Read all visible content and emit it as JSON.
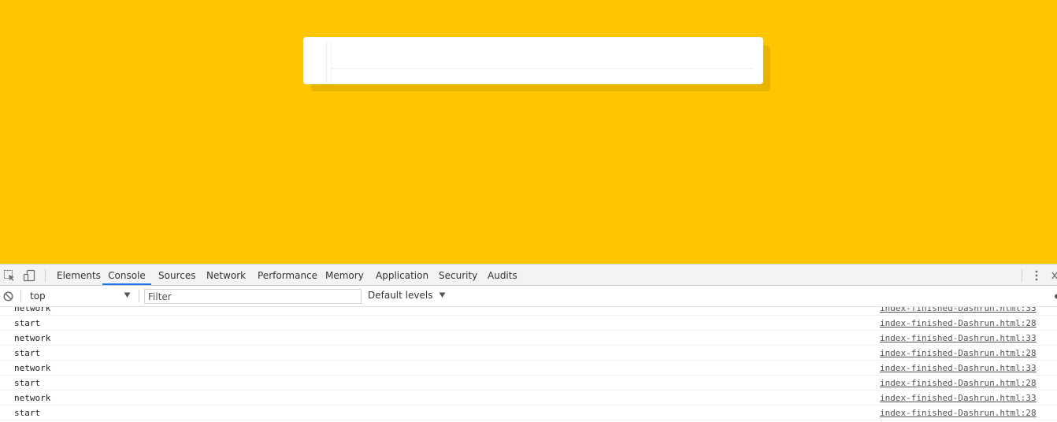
{
  "page": {
    "background_color": "#ffc600",
    "card_color": "#ffffff"
  },
  "devtools": {
    "toolbar_icons": [
      "inspect-element-icon",
      "device-toolbar-icon"
    ],
    "tabs": [
      {
        "label": "Elements",
        "active": false
      },
      {
        "label": "Console",
        "active": true
      },
      {
        "label": "Sources",
        "active": false
      },
      {
        "label": "Network",
        "active": false
      },
      {
        "label": "Performance",
        "active": false
      },
      {
        "label": "Memory",
        "active": false
      },
      {
        "label": "Application",
        "active": false
      },
      {
        "label": "Security",
        "active": false
      },
      {
        "label": "Audits",
        "active": false
      }
    ],
    "accent_color": "#1a73e8",
    "console_toolbar": {
      "context": "top",
      "filter_placeholder": "Filter",
      "filter_value": "",
      "levels": "Default levels"
    },
    "logs": [
      {
        "message": "network",
        "source": "index-finished-Dashrun.html:33"
      },
      {
        "message": "start",
        "source": "index-finished-Dashrun.html:28"
      },
      {
        "message": "network",
        "source": "index-finished-Dashrun.html:33"
      },
      {
        "message": "start",
        "source": "index-finished-Dashrun.html:28"
      },
      {
        "message": "network",
        "source": "index-finished-Dashrun.html:33"
      },
      {
        "message": "start",
        "source": "index-finished-Dashrun.html:28"
      },
      {
        "message": "network",
        "source": "index-finished-Dashrun.html:33"
      },
      {
        "message": "start",
        "source": "index-finished-Dashrun.html:28"
      }
    ]
  }
}
